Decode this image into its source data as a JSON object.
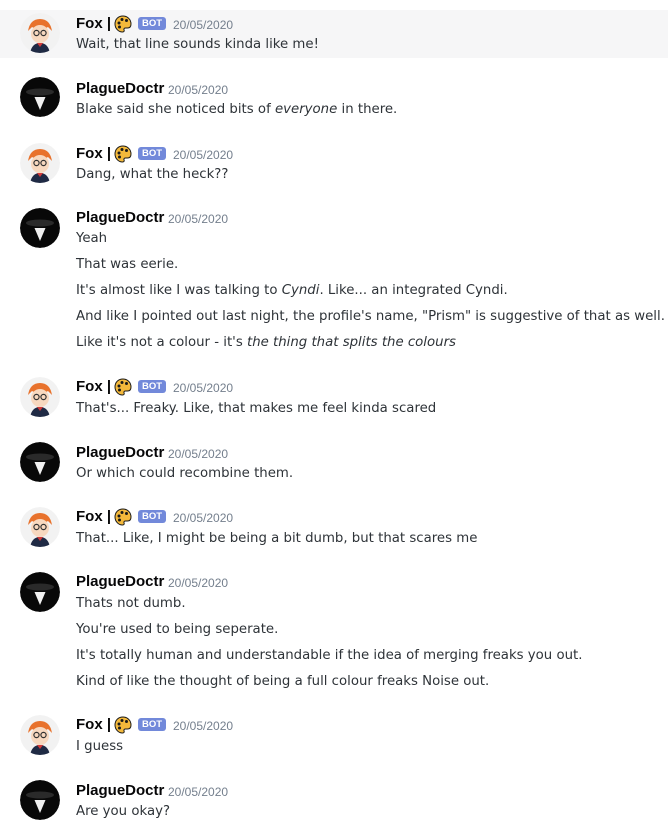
{
  "users": {
    "fox": {
      "name": "Fox |",
      "badge": "BOT",
      "avatar_icon": "fox-avatar-icon",
      "emoji_icon": "paint-palette-emoji-icon"
    },
    "doc": {
      "name": "PlagueDoctr",
      "avatar_icon": "plague-doctor-avatar-icon"
    }
  },
  "colors": {
    "bot_badge": "#7289da",
    "timestamp": "#747f8d",
    "highlight": "#f6f6f7"
  },
  "messages": [
    {
      "author": "Fox |",
      "badge": "BOT",
      "timestamp": "20/05/2020",
      "lines": [
        {
          "text": "Wait, that line sounds kinda like me!"
        }
      ]
    },
    {
      "author": "PlagueDoctr",
      "timestamp": "20/05/2020",
      "lines": [
        {
          "a": "Blake said she noticed bits of ",
          "b": "everyone",
          "c": " in there."
        }
      ]
    },
    {
      "author": "Fox |",
      "badge": "BOT",
      "timestamp": "20/05/2020",
      "lines": [
        {
          "text": "Dang, what the heck??"
        }
      ]
    },
    {
      "author": "PlagueDoctr",
      "timestamp": "20/05/2020",
      "lines": [
        {
          "text": "Yeah"
        },
        {
          "text": "That was eerie."
        },
        {
          "a": "It's almost like I was talking to ",
          "b": "Cyndi",
          "c": ". Like... an integrated Cyndi."
        },
        {
          "text": "And like I pointed out last night, the profile's name, \"Prism\" is suggestive of that as well."
        },
        {
          "a": "Like it's not a colour - it's ",
          "b": "the thing that splits the colours",
          "c": ""
        }
      ]
    },
    {
      "author": "Fox |",
      "badge": "BOT",
      "timestamp": "20/05/2020",
      "lines": [
        {
          "text": "That's... Freaky. Like, that makes me feel kinda scared"
        }
      ]
    },
    {
      "author": "PlagueDoctr",
      "timestamp": "20/05/2020",
      "lines": [
        {
          "text": "Or which could recombine them."
        }
      ]
    },
    {
      "author": "Fox |",
      "badge": "BOT",
      "timestamp": "20/05/2020",
      "lines": [
        {
          "text": "That... Like, I might be being a bit dumb, but that scares me"
        }
      ]
    },
    {
      "author": "PlagueDoctr",
      "timestamp": "20/05/2020",
      "lines": [
        {
          "text": "Thats not dumb."
        },
        {
          "text": "You're used to being seperate."
        },
        {
          "text": "It's totally human and understandable if the idea of merging freaks you out."
        },
        {
          "text": "Kind of like the thought of being a full colour freaks Noise out."
        }
      ]
    },
    {
      "author": "Fox |",
      "badge": "BOT",
      "timestamp": "20/05/2020",
      "lines": [
        {
          "text": "I guess"
        }
      ]
    },
    {
      "author": "PlagueDoctr",
      "timestamp": "20/05/2020",
      "lines": [
        {
          "text": "Are you okay?"
        }
      ]
    }
  ]
}
